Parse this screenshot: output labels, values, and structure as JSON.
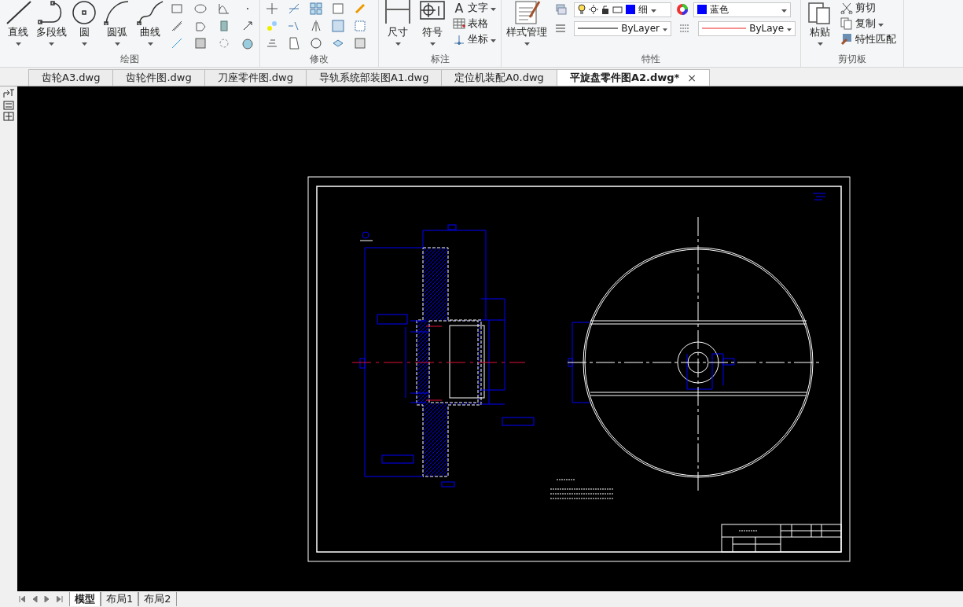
{
  "ribbon": {
    "groups": [
      {
        "label": "绘图",
        "large_tools": [
          {
            "label": "直线"
          },
          {
            "label": "多段线"
          },
          {
            "label": "圆"
          },
          {
            "label": "圆弧"
          },
          {
            "label": "曲线"
          }
        ]
      },
      {
        "label": "修改"
      },
      {
        "label": "标注",
        "large_tools": [
          {
            "label": "尺寸"
          },
          {
            "label": "符号"
          }
        ],
        "small_tools": [
          {
            "label": "文字",
            "glyph": "A"
          },
          {
            "label": "表格"
          },
          {
            "label": "坐标"
          }
        ]
      },
      {
        "label": "特性",
        "large_tools": [
          {
            "label": "样式管理"
          }
        ],
        "layer_value": "细",
        "color_value": "蓝色",
        "linetype_value": "ByLayer",
        "lineweight_value": "ByLaye"
      },
      {
        "label": "剪切板",
        "large_tools": [
          {
            "label": "粘贴"
          }
        ],
        "small_tools": [
          {
            "label": "剪切"
          },
          {
            "label": "复制"
          },
          {
            "label": "特性匹配"
          }
        ]
      }
    ]
  },
  "document_tabs": [
    {
      "label": "齿轮A3.dwg",
      "selected": false
    },
    {
      "label": "齿轮件图.dwg",
      "selected": false
    },
    {
      "label": "刀座零件图.dwg",
      "selected": false
    },
    {
      "label": "导轨系统部装图A1.dwg",
      "selected": false
    },
    {
      "label": "定位机装配A0.dwg",
      "selected": false
    },
    {
      "label": "平旋盘零件图A2.dwg*",
      "selected": true,
      "close": "×"
    }
  ],
  "layout_tabs": [
    {
      "label": "模型",
      "selected": true
    },
    {
      "label": "布局1",
      "selected": false
    },
    {
      "label": "布局2",
      "selected": false
    }
  ]
}
